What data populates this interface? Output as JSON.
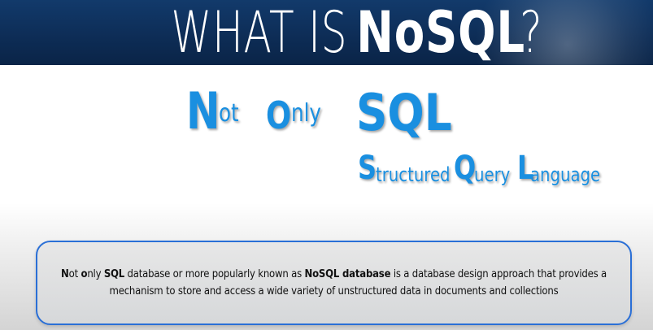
{
  "header": {
    "title_part1": "WHAT IS ",
    "title_part2": "NoSQL",
    "title_part3": "?"
  },
  "acronym": {
    "not": {
      "initial": "N",
      "rest": "ot"
    },
    "only": {
      "initial": "O",
      "rest": "nly"
    },
    "sql": {
      "text": "SQL"
    },
    "structured": {
      "initial": "S",
      "rest": "tructured"
    },
    "query": {
      "initial": "Q",
      "rest": "uery"
    },
    "language": {
      "initial": "L",
      "rest": "anguage"
    }
  },
  "definition": {
    "n": "N",
    "ot": "ot ",
    "o": "o",
    "nly": "nly ",
    "sql": "SQL",
    "mid": " database or more popularly known as ",
    "nosql_db": "NoSQL database",
    "end": " is a database design approach that provides a mechanism to store and access a wide variety of unstructured data in documents and collections"
  },
  "colors": {
    "header_bg": "#0d2c55",
    "accent_blue": "#1a8fe0",
    "box_border": "#2a6fd6"
  }
}
